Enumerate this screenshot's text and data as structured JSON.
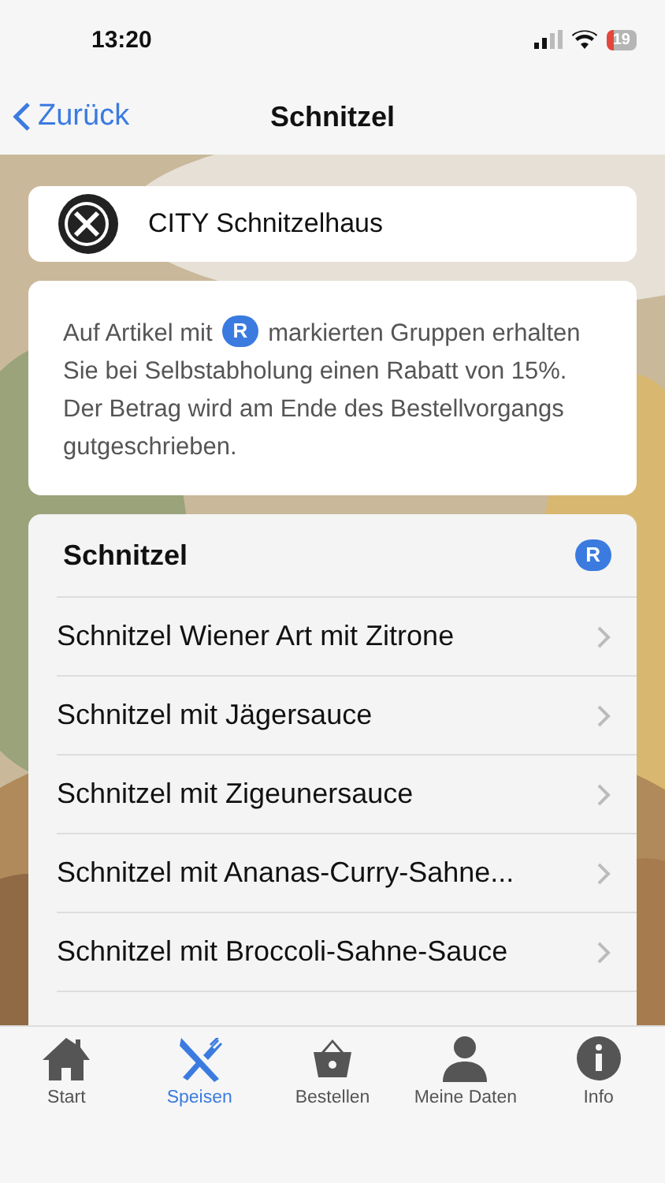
{
  "status_bar": {
    "time": "13:20",
    "battery": "19"
  },
  "nav": {
    "back": "Zurück",
    "title": "Schnitzel"
  },
  "restaurant": {
    "name": "CITY Schnitzelhaus"
  },
  "info": {
    "before": "Auf Artikel mit",
    "badge": "R",
    "after": "markierten Gruppen erhalten Sie bei Selbstabholung einen Rabatt von 15%. Der Betrag wird am Ende des Bestellvorgangs gutgeschrieben."
  },
  "group": {
    "title": "Schnitzel",
    "badge": "R",
    "items": [
      {
        "label": "Schnitzel Wiener Art mit Zitrone"
      },
      {
        "label": "Schnitzel mit Jägersauce"
      },
      {
        "label": "Schnitzel mit Zigeunersauce"
      },
      {
        "label": "Schnitzel mit Ananas-Curry-Sahne..."
      },
      {
        "label": "Schnitzel mit Broccoli-Sahne-Sauce"
      }
    ]
  },
  "tabs": [
    {
      "kind": "home",
      "label": "Start",
      "selected": false
    },
    {
      "kind": "food",
      "label": "Speisen",
      "selected": true
    },
    {
      "kind": "basket",
      "label": "Bestellen",
      "selected": false
    },
    {
      "kind": "person",
      "label": "Meine Daten",
      "selected": false
    },
    {
      "kind": "info",
      "label": "Info",
      "selected": false
    }
  ]
}
